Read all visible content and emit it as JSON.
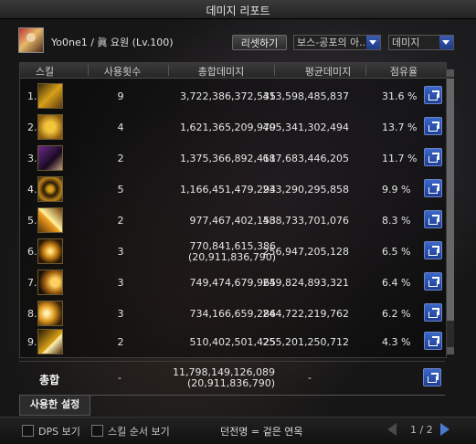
{
  "window": {
    "title": "데미지 리포트"
  },
  "user": {
    "name": "Yo0ne1 / 眞 요원 (Lv.100)"
  },
  "controls": {
    "reset_label": "리셋하기",
    "boss_select": "보스-공포의 아..",
    "metric_select": "데미지"
  },
  "table": {
    "headers": [
      "스킬",
      "사용횟수",
      "총합데미지",
      "평균데미지",
      "점유율"
    ],
    "rows": [
      {
        "rank": "1.",
        "uses": "9",
        "total": "3,722,386,372,535",
        "total_sub": "",
        "avg": "413,598,485,837",
        "share": "31.6 %"
      },
      {
        "rank": "2.",
        "uses": "4",
        "total": "1,621,365,209,979",
        "total_sub": "",
        "avg": "405,341,302,494",
        "share": "13.7 %"
      },
      {
        "rank": "3.",
        "uses": "2",
        "total": "1,375,366,892,411",
        "total_sub": "",
        "avg": "687,683,446,205",
        "share": "11.7 %"
      },
      {
        "rank": "4.",
        "uses": "5",
        "total": "1,166,451,479,294",
        "total_sub": "",
        "avg": "233,290,295,858",
        "share": "9.9 %"
      },
      {
        "rank": "5.",
        "uses": "2",
        "total": "977,467,402,153",
        "total_sub": "",
        "avg": "488,733,701,076",
        "share": "8.3 %"
      },
      {
        "rank": "6.",
        "uses": "3",
        "total": "770,841,615,386",
        "total_sub": "(20,911,836,790)",
        "avg": "256,947,205,128",
        "share": "6.5 %"
      },
      {
        "rank": "7.",
        "uses": "3",
        "total": "749,474,679,965",
        "total_sub": "",
        "avg": "249,824,893,321",
        "share": "6.4 %"
      },
      {
        "rank": "8.",
        "uses": "3",
        "total": "734,166,659,286",
        "total_sub": "",
        "avg": "244,722,219,762",
        "share": "6.2 %"
      },
      {
        "rank": "9.",
        "uses": "2",
        "total": "510,402,501,425",
        "total_sub": "",
        "avg": "255,201,250,712",
        "share": "4.3 %"
      }
    ],
    "skill_icons": [
      "sword-skill-icon",
      "gold-emblem-skill-icon",
      "shadow-portrait-skill-icon",
      "crosshair-skill-icon",
      "slash-skill-icon",
      "whirlwind-skill-icon",
      "arc-skill-icon",
      "burst-skill-icon",
      "blade-skill-icon"
    ]
  },
  "summary": {
    "label": "총합",
    "uses": "-",
    "total": "11,798,149,126,089",
    "total_sub": "(20,911,836,790)",
    "avg": "-"
  },
  "tabs": {
    "active": "사용한 설정"
  },
  "footer": {
    "dps_label": "DPS 보기",
    "skill_order_label": "스킬 순서 보기",
    "hint": "던전명 = 겉은 연옥",
    "page": "1 / 2"
  },
  "colors": {
    "accent": "#2d58c4",
    "gold": "#d9a017"
  }
}
